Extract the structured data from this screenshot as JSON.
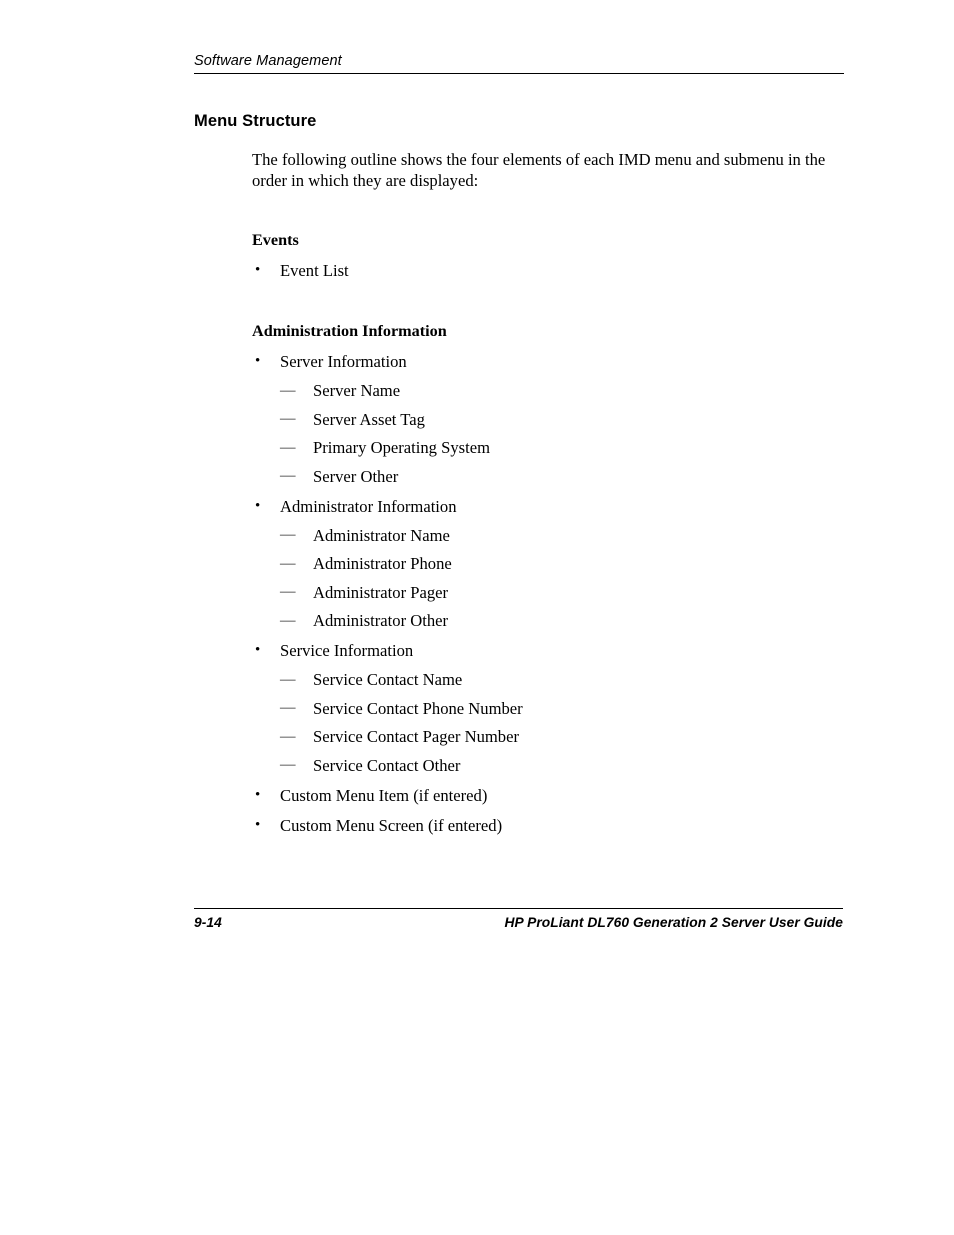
{
  "header": {
    "running_head": "Software Management"
  },
  "section": {
    "heading": "Menu Structure",
    "intro": "The following outline shows the four elements of each IMD menu and submenu in the order in which they are displayed:"
  },
  "outline": [
    {
      "heading": "Events",
      "items": [
        {
          "label": "Event List",
          "subitems": []
        }
      ]
    },
    {
      "heading": "Administration Information",
      "items": [
        {
          "label": "Server Information",
          "subitems": [
            "Server Name",
            "Server Asset Tag",
            "Primary Operating System",
            "Server Other"
          ]
        },
        {
          "label": "Administrator Information",
          "subitems": [
            "Administrator Name",
            "Administrator Phone",
            "Administrator Pager",
            "Administrator Other"
          ]
        },
        {
          "label": "Service Information",
          "subitems": [
            "Service Contact Name",
            "Service Contact Phone Number",
            "Service Contact Pager Number",
            "Service Contact Other"
          ]
        },
        {
          "label": "Custom Menu Item (if entered)",
          "subitems": []
        },
        {
          "label": "Custom Menu Screen (if entered)",
          "subitems": []
        }
      ]
    }
  ],
  "marks": {
    "bullet": "•",
    "dash": "—"
  },
  "footer": {
    "page_number": "9-14",
    "guide_title": "HP ProLiant DL760 Generation 2 Server User Guide"
  }
}
